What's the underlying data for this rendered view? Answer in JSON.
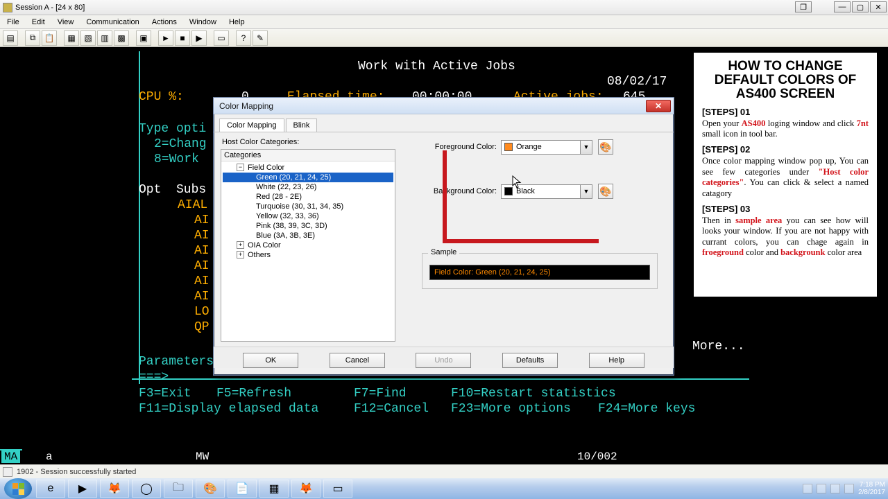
{
  "window": {
    "title": "Session A - [24 x 80]"
  },
  "menus": [
    "File",
    "Edit",
    "View",
    "Communication",
    "Actions",
    "Window",
    "Help"
  ],
  "term": {
    "title": "Work with Active Jobs",
    "date": "08/02/17",
    "cpu_label": "CPU %:",
    "cpu_val": "0",
    "elapsed_label": "Elapsed time:",
    "elapsed_val": "00:00:00",
    "active_label": "Active jobs:",
    "active_val": "645",
    "type_opt": "Type opti",
    "opt2": "2=Chang",
    "opt8": "8=Work",
    "hdr": "Opt  Subs",
    "row1": "AIAL",
    "rows": [
      "AI",
      "AI",
      "AI",
      "AI",
      "AI",
      "AI",
      "LO",
      "QP"
    ],
    "params": "Parameters",
    "prompt": "===>",
    "more": "More...",
    "f3": "F3=Exit",
    "f5": "F5=Refresh",
    "f7": "F7=Find",
    "f10": "F10=Restart statistics",
    "f11": "F11=Display elapsed data",
    "f12": "F12=Cancel",
    "f23": "F23=More options",
    "f24": "F24=More keys",
    "oia_ma": "MA",
    "oia_a": "a",
    "oia_mw": "MW",
    "oia_pos": "10/002"
  },
  "dlg": {
    "title": "Color Mapping",
    "tabs": {
      "t1": "Color Mapping",
      "t2": "Blink"
    },
    "hcc": "Host Color Categories:",
    "cat_hdr": "Categories",
    "tree": {
      "root": "Field Color",
      "items": [
        "Green (20, 21, 24, 25)",
        "White (22, 23, 26)",
        "Red (28 - 2E)",
        "Turquoise (30, 31, 34, 35)",
        "Yellow (32, 33, 36)",
        "Pink (38, 39, 3C, 3D)",
        "Blue (3A, 3B, 3E)"
      ],
      "oia": "OIA Color",
      "others": "Others"
    },
    "fg_label": "Foreground Color:",
    "fg_value": "Orange",
    "bg_label": "Background Color:",
    "bg_value": "Black",
    "sample_label": "Sample",
    "sample_text": "Field Color: Green (20, 21, 24, 25)",
    "btns": {
      "ok": "OK",
      "cancel": "Cancel",
      "undo": "Undo",
      "defaults": "Defaults",
      "help": "Help"
    }
  },
  "panel": {
    "heading": "HOW TO CHANGE DEFAULT COLORS OF AS400 SCREEN",
    "s1": "[STEPS] 01",
    "p1a": "Open your ",
    "p1b": "AS400",
    "p1c": " loging window and click ",
    "p1d": "7nt",
    "p1e": " small icon in tool bar.",
    "s2": "[STEPS] 02",
    "p2a": "Once color mapping window pop up, You can see few categories under ",
    "p2b": "\"Host color categories\"",
    "p2c": ". You can click & select a named catagory",
    "s3": "[STEPS] 03",
    "p3a": "Then in ",
    "p3b": "sample area",
    "p3c": " you can see how will looks your window. If you are not happy with currant colors, you can chage again in ",
    "p3d": "froeground",
    "p3e": " color and ",
    "p3f": "backgrounk",
    "p3g": " color area"
  },
  "status": {
    "text": "1902 - Session successfully started"
  },
  "tray": {
    "time": "7:18 PM",
    "date": "2/8/2017"
  },
  "colors": {
    "orange": "#ff8a1e",
    "black": "#000000"
  }
}
